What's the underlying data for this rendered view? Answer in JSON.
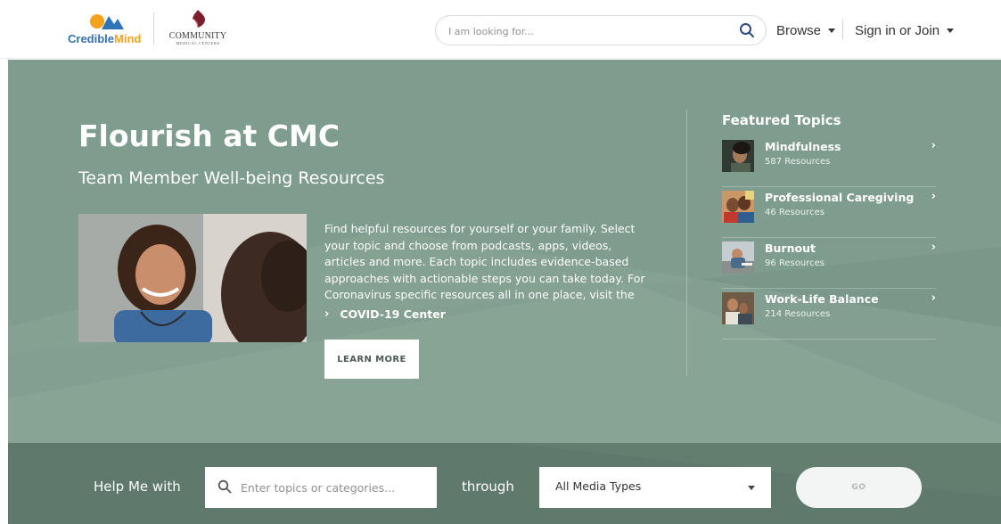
{
  "header": {
    "logo_primary": {
      "part1": "Credible",
      "part2": "Mind"
    },
    "logo_partner": {
      "name": "COMMUNITY",
      "subtitle": "MEDICAL CENTERS"
    },
    "search": {
      "placeholder": "I am looking for...",
      "icon": "search-icon"
    },
    "nav": {
      "browse_label": "Browse",
      "sign_in_label": "Sign in or Join"
    }
  },
  "hero": {
    "title": "Flourish at CMC",
    "subtitle": "Team Member Well-being Resources",
    "description": "Find helpful resources for yourself or your family. Select your topic and choose from podcasts, apps, videos, articles and more. Each topic includes evidence-based approaches with actionable steps you can take today. For Coronavirus specific resources all in one place, visit the",
    "covid_link": "COVID-19 Center",
    "learn_more": "LEARN MORE"
  },
  "featured": {
    "heading": "Featured Topics",
    "topics": [
      {
        "name": "Mindfulness",
        "count": "587 Resources"
      },
      {
        "name": "Professional Caregiving",
        "count": "46 Resources"
      },
      {
        "name": "Burnout",
        "count": "96 Resources"
      },
      {
        "name": "Work-Life Balance",
        "count": "214 Resources"
      }
    ]
  },
  "filter": {
    "help_label": "Help Me with",
    "topic_placeholder": "Enter topics or categories...",
    "through_label": "through",
    "media_value": "All Media Types",
    "go_label": "GO"
  },
  "colors": {
    "hero_bg": "#7a9889",
    "filter_bg": "#5f7a6c",
    "brand_blue": "#2f73b8",
    "brand_orange": "#f4a21b",
    "cmc_maroon": "#7a1f2b"
  }
}
